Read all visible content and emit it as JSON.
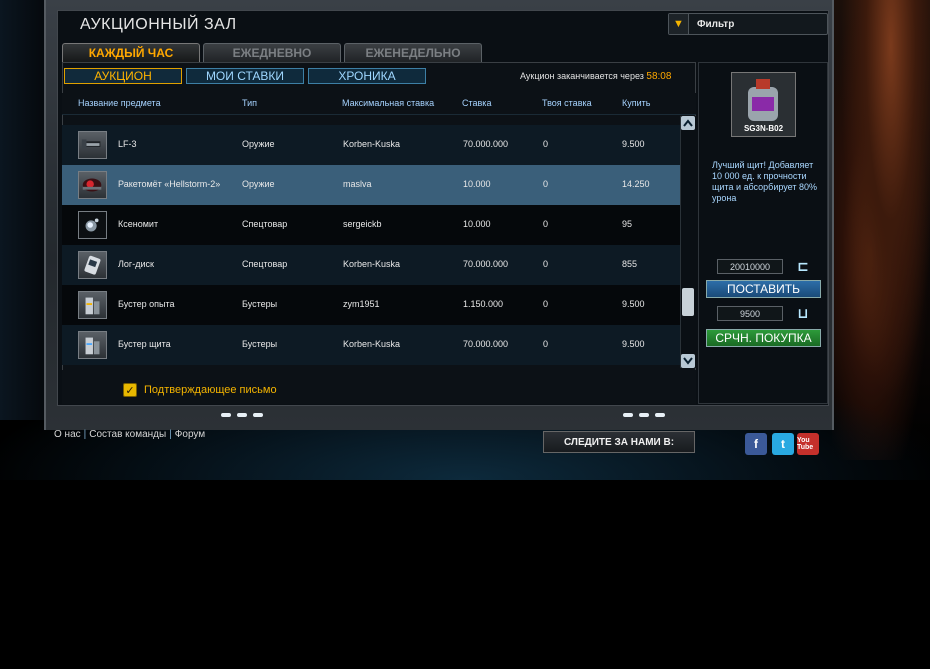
{
  "window": {
    "title": "АУКЦИОННЫЙ ЗАЛ",
    "filter_label": "Фильтр"
  },
  "tabs": [
    {
      "label": "КАЖДЫЙ ЧАС",
      "active": true
    },
    {
      "label": "ЕЖЕДНЕВНО",
      "active": false
    },
    {
      "label": "ЕЖЕНЕДЕЛЬНО",
      "active": false
    }
  ],
  "subtabs": [
    {
      "label": "АУКЦИОН",
      "active": true
    },
    {
      "label": "МОИ СТАВКИ",
      "active": false
    },
    {
      "label": "ХРОНИКА",
      "active": false
    }
  ],
  "auction_end": {
    "label": "Аукцион заканчивается через",
    "time": "58:08"
  },
  "table": {
    "headers": [
      "Название предмета",
      "Тип",
      "Максимальная ставка",
      "Ставка",
      "Твоя ставка",
      "Купить"
    ],
    "rows": [
      {
        "name": "LF-3",
        "type": "Оружие",
        "max_bid": "Korben-Kuska",
        "bid": "70.000.000",
        "your_bid": "0",
        "buy": "9.500",
        "icon": "laser-cannon-icon"
      },
      {
        "name": "Ракетомёт «Hellstorm-2»",
        "type": "Оружие",
        "max_bid": "maslva",
        "bid": "10.000",
        "your_bid": "0",
        "buy": "14.250",
        "icon": "rocket-launcher-icon",
        "selected": true
      },
      {
        "name": "Ксеномит",
        "type": "Спецтовар",
        "max_bid": "sergeickb",
        "bid": "10.000",
        "your_bid": "0",
        "buy": "95",
        "icon": "xenomit-icon"
      },
      {
        "name": "Лог-диск",
        "type": "Спецтовар",
        "max_bid": "Korben-Kuska",
        "bid": "70.000.000",
        "your_bid": "0",
        "buy": "855",
        "icon": "logdisk-icon"
      },
      {
        "name": "Бустер опыта",
        "type": "Бустеры",
        "max_bid": "zym1951",
        "bid": "1.150.000",
        "your_bid": "0",
        "buy": "9.500",
        "icon": "booster-icon"
      },
      {
        "name": "Бустер щита",
        "type": "Бустеры",
        "max_bid": "Korben-Kuska",
        "bid": "70.000.000",
        "your_bid": "0",
        "buy": "9.500",
        "icon": "booster-icon"
      }
    ]
  },
  "confirm": {
    "label": "Подтверждающее письмо",
    "checked": true
  },
  "side": {
    "item_name": "SG3N-B02",
    "description": "Лучший щит! Добавляет 10 000 ед. к прочности щита и абсорбирует 80% урона",
    "bid_value": "20010000",
    "place_label": "ПОСТАВИТЬ",
    "buy_value": "9500",
    "buy_label": "СРЧН. ПОКУПКА"
  },
  "footer": {
    "links": [
      "О нас",
      "Состав команды",
      "Форум"
    ],
    "follow_label": "СЛЕДИТЕ ЗА НАМИ В:",
    "youtube_label": "You Tube"
  },
  "colors": {
    "accent": "#ffa800",
    "link_blue": "#a6d3ff",
    "selected_row": "#3a5f7a"
  }
}
